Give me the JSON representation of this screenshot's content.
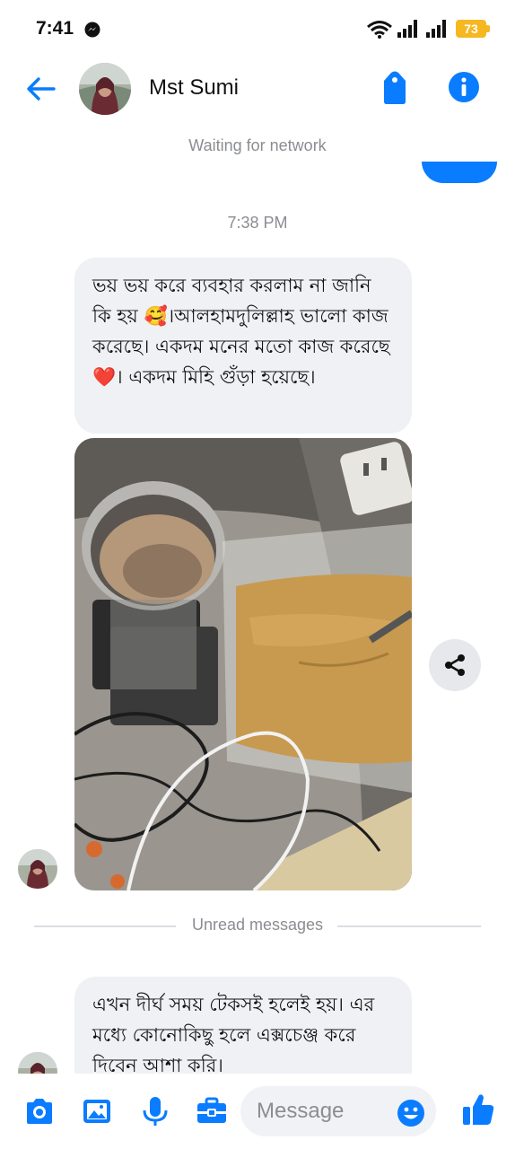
{
  "status_bar": {
    "time": "7:41",
    "battery": "73",
    "icons": [
      "messenger-icon",
      "wifi-icon",
      "signal-icon",
      "signal-icon",
      "battery-icon"
    ]
  },
  "header": {
    "contact_name": "Mst Sumi",
    "icons": [
      "back-arrow-icon",
      "tag-icon",
      "info-icon"
    ]
  },
  "network_status": "Waiting for network",
  "timestamp": "7:38 PM",
  "messages": [
    {
      "text": "ভয় ভয় করে ব্যবহার করলাম না জানি কি হয় 🥰।আলহামদুলিল্লাহ ভালো কাজ করেছে। একদম মনের মতো কাজ করেছে ❤️। একদম মিহি গুঁড়া হয়েছে।"
    },
    {
      "text": "এখন দীর্ঘ সময় টেকসই হলেই হয়। এর মধ্যে কোনোকিছু হলে এক্সচেঞ্জ করে দিবেন আশা করি।"
    }
  ],
  "unread_label": "Unread messages",
  "composer": {
    "placeholder": "Message",
    "icons": [
      "camera-icon",
      "gallery-icon",
      "microphone-icon",
      "toolbox-icon",
      "emoji-icon",
      "thumbs-up-icon"
    ]
  },
  "colors": {
    "accent": "#0a7cff",
    "bubble": "#eff1f4",
    "muted_text": "#8a8d91",
    "battery": "#f5b820"
  }
}
